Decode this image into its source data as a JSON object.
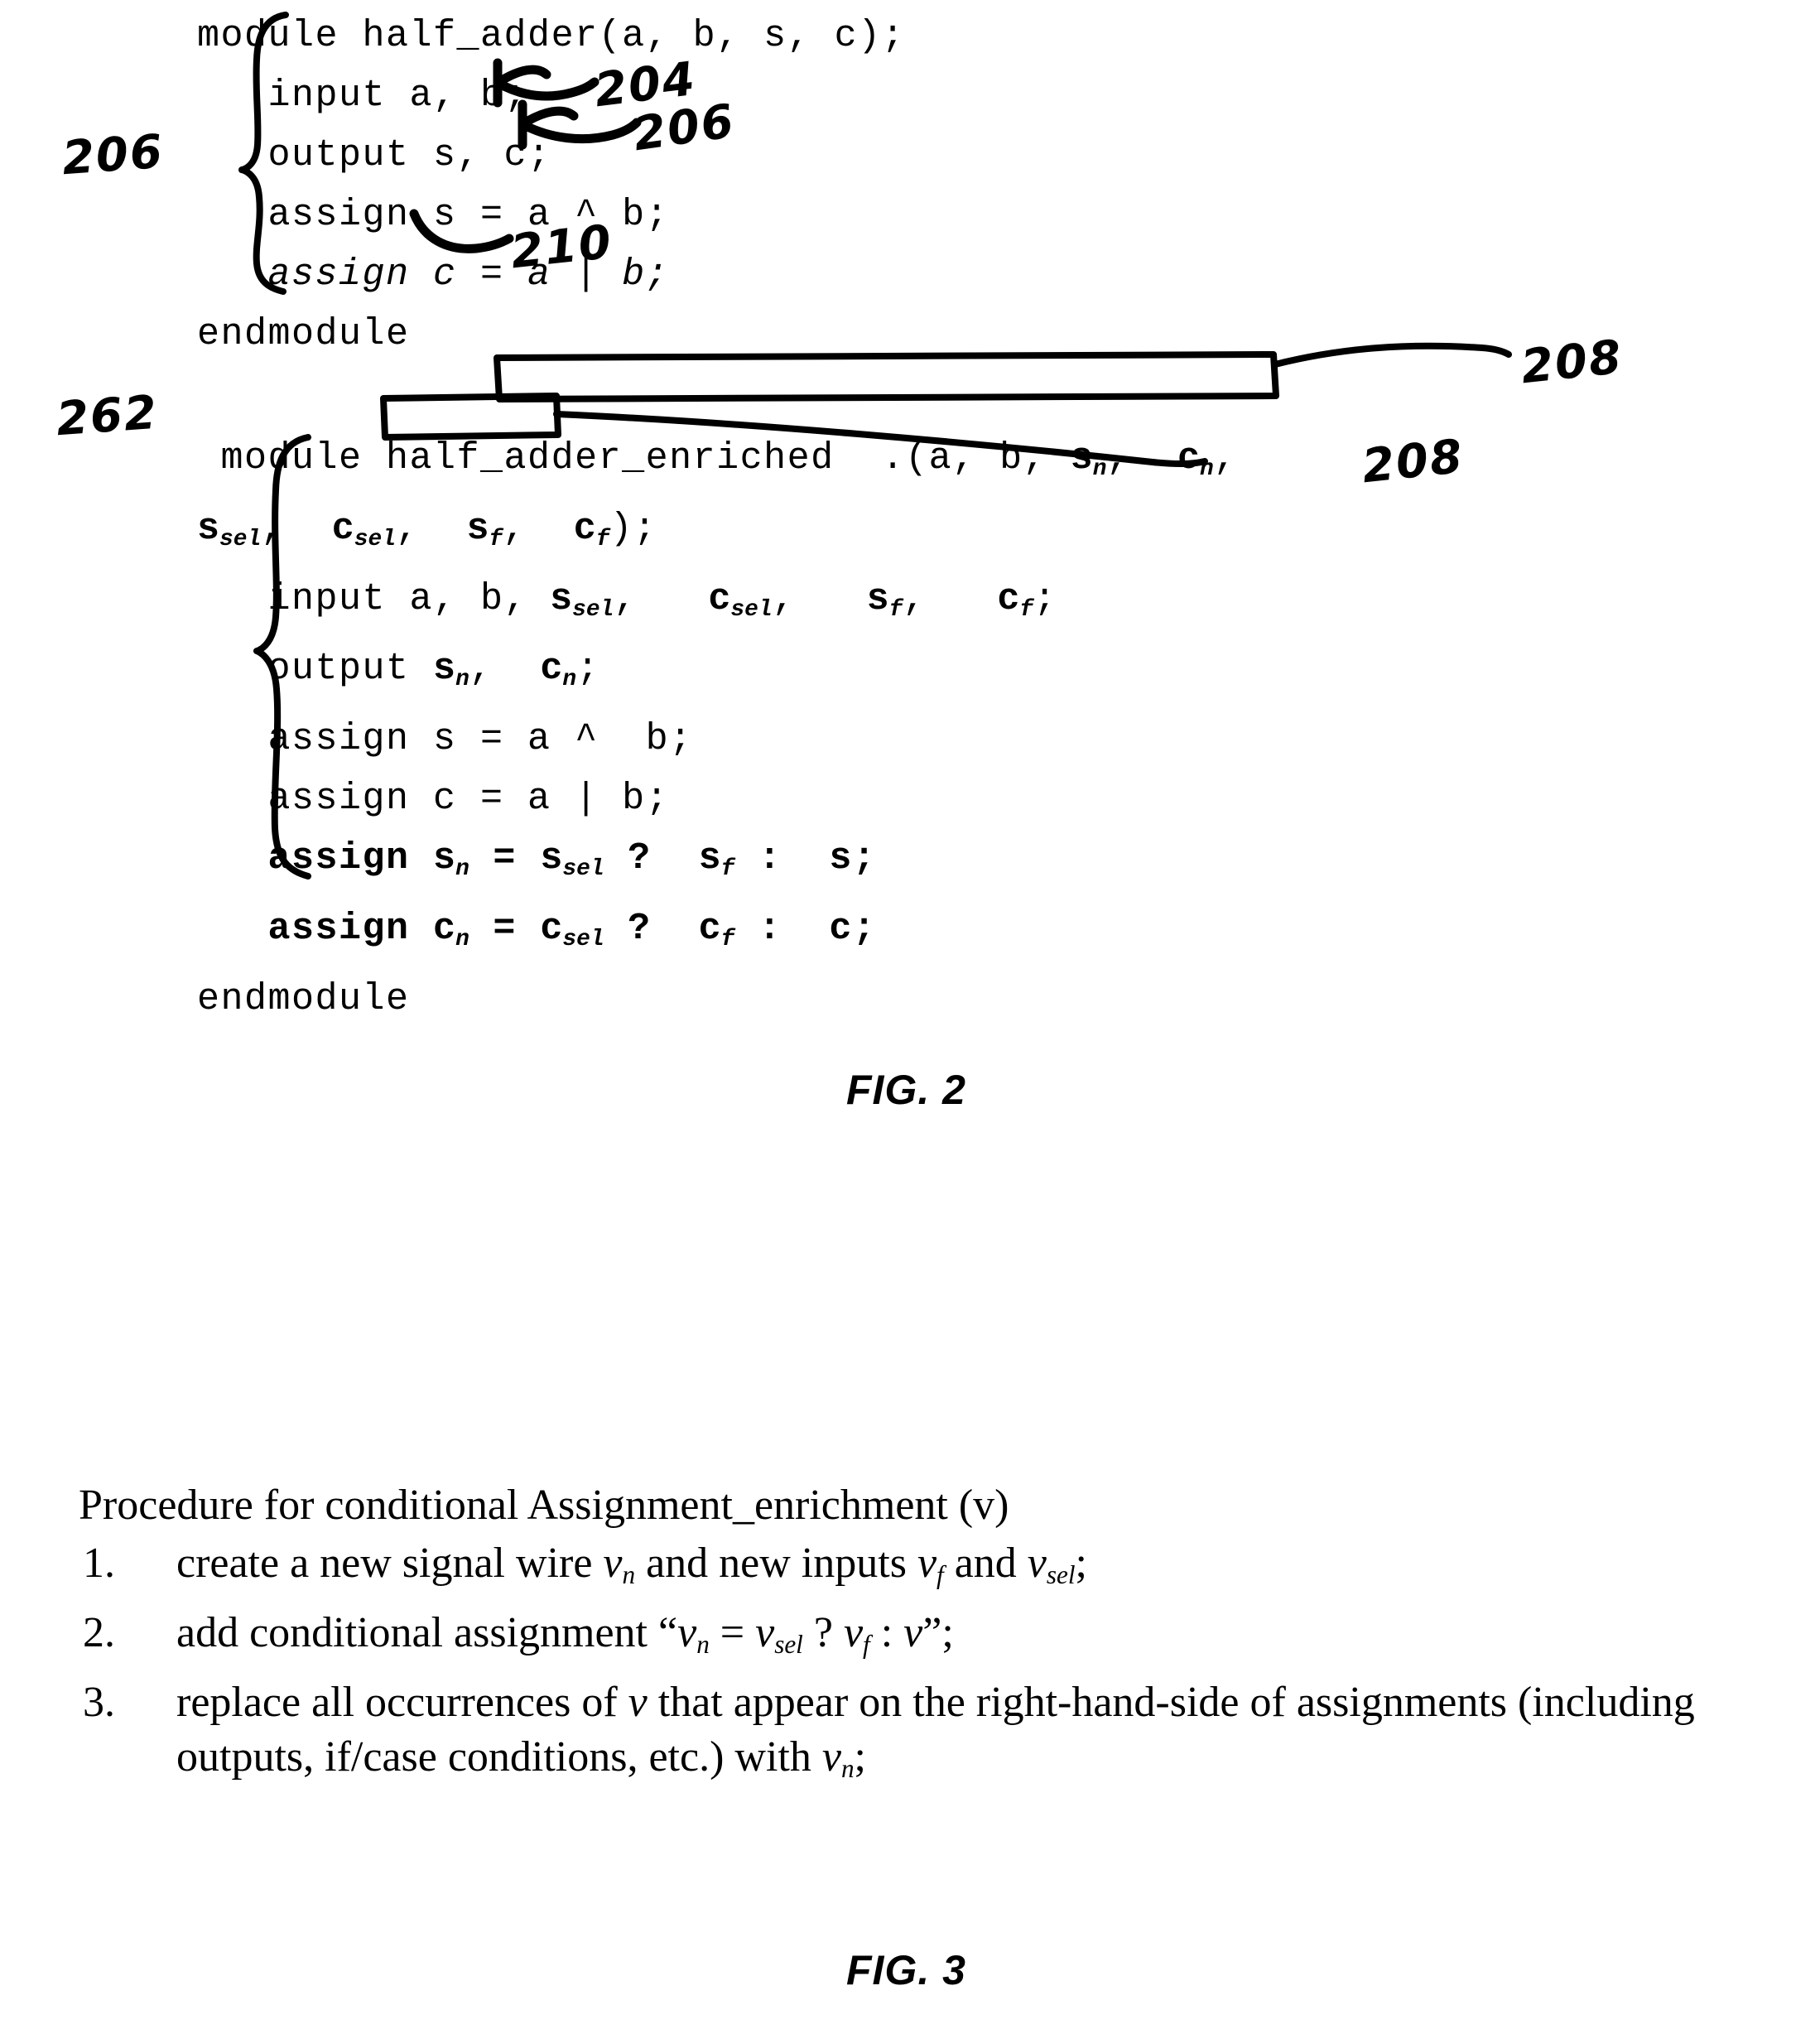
{
  "figure2": {
    "block1": {
      "ref_label": "206",
      "lines": [
        {
          "id": "l1",
          "text": "module half_adder(a, b, s, c);",
          "style": "normal"
        },
        {
          "id": "l2",
          "text": "   input a, b;",
          "style": "normal"
        },
        {
          "id": "l3",
          "text": "   output s, c;",
          "style": "normal"
        },
        {
          "id": "l4",
          "text": "   assign s = a ^ b;",
          "style": "normal"
        },
        {
          "id": "l5",
          "text": "   assign c = a | b;",
          "style": "italic"
        },
        {
          "id": "l6",
          "text": "endmodule",
          "style": "normal"
        }
      ]
    },
    "block2": {
      "ref_label": "262",
      "line1_a": " module half_adder_enriched  .(a, b, ",
      "line1_sn": "s",
      "line1_sn_sub": "n",
      "line1_cn": "c",
      "line1_cn_sub": "n",
      "line2_prefix": "",
      "line2_tokens": "s_sel, c_sel, s_f, c_f);",
      "line3_prefix": "   input a, b,",
      "line3_boxed": "s_sel, c_sel, s_f, c_f;",
      "line4_prefix": "   output",
      "line4_boxed": "s_n, c_n;",
      "line5": "   assign s = a ^ b;",
      "line6": "   assign c = a | b;",
      "line7": "   assign s_n = s_sel ? s_f : s;",
      "line8": "   assign c_n = c_sel ? c_f : c;",
      "line9": "endmodule"
    },
    "annotations": [
      {
        "id": "a204",
        "text": "204",
        "points_to": "input a, b;"
      },
      {
        "id": "a206",
        "text": "206",
        "points_to": "output s, c;"
      },
      {
        "id": "a210",
        "text": "210",
        "points_to": "endmodule"
      },
      {
        "id": "a208a",
        "text": "208",
        "points_to": "input boxed signals"
      },
      {
        "id": "a208b",
        "text": "208",
        "points_to": "output boxed signals"
      }
    ],
    "caption": "FIG. 2"
  },
  "figure3": {
    "title": "Procedure for conditional Assignment_enrichment (v)",
    "items": [
      {
        "num": "1.",
        "id": "step1"
      },
      {
        "num": "2.",
        "id": "step2"
      },
      {
        "num": "3.",
        "id": "step3"
      }
    ],
    "step1_parts": {
      "p1": "create a new signal wire ",
      "v1": "v",
      "v1sub": "n",
      "p2": " and new inputs ",
      "v2": "v",
      "v2sub": "f",
      "p3": " and ",
      "v3": "v",
      "v3sub": "sel",
      "p4": ";"
    },
    "step2_parts": {
      "p1": "add conditional assignment “",
      "v1": "v",
      "v1sub": "n",
      "p2": " = ",
      "v2": "v",
      "v2sub": "sel",
      "p3": " ? ",
      "v3": "v",
      "v3sub": "f",
      "p4": " : ",
      "v4": "v",
      "p5": "”;"
    },
    "step3_parts": {
      "p1": "replace all occurrences of ",
      "v1": "v",
      "p2": " that appear on the right-hand-side of assignments (including outputs, if/case conditions, etc.) with ",
      "v2": "v",
      "v2sub": "n",
      "p3": ";"
    },
    "caption": "FIG. 3"
  },
  "colors": {
    "ink": "#000000",
    "background": "#ffffff"
  }
}
